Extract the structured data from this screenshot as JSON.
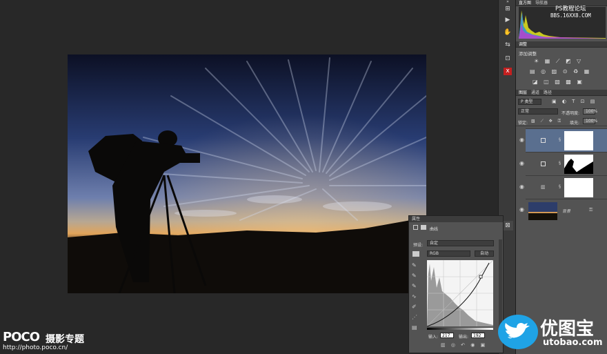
{
  "toolstrip": {
    "collapse": "»",
    "items": [
      "⊞",
      "▶",
      "✋",
      "⇆",
      "⊡",
      "⊠",
      "x"
    ]
  },
  "panels": {
    "histogram_tabs": [
      "直方图",
      "导航器"
    ],
    "adjustments_tab": "调整",
    "add_adjustment": "添加调整",
    "adj_row1": "☀ ▦ ⟋ ◩ ▽",
    "adj_row2": "▤ ◎ ▨ ⊙ ♻ ▦",
    "adj_row3": "◪ ◫ ▧ ▩ ▣",
    "layers_tabs": [
      "图层",
      "通道",
      "路径"
    ],
    "filter_kind": "P 类型",
    "blend_mode": "正常",
    "opacity_label": "不透明度:",
    "opacity_value": "100%",
    "lock_label": "锁定:",
    "fill_label": "填充:",
    "fill_value": "100%",
    "layers": [
      {
        "name": ""
      },
      {
        "name": ""
      },
      {
        "name": ""
      },
      {
        "name": "背景"
      }
    ]
  },
  "properties": {
    "title": "属性",
    "panel_name": "曲线",
    "preset_label": "预设:",
    "preset_value": "自定",
    "channel_value": "RGB",
    "auto_button": "自动",
    "input_label": "输入:",
    "input_value": "217",
    "output_label": "输出:",
    "output_value": "192"
  },
  "watermarks": {
    "ps_title": "PS教程论坛",
    "ps_url": "BBS.16XX8.COM",
    "poco_brand": "POCO",
    "poco_title": "摄影专题",
    "poco_url": "http://photo.poco.cn/",
    "utobao_title": "优图宝",
    "utobao_url": "utobao.com"
  },
  "colors": {
    "workspace": "#282828",
    "panel": "#535353",
    "dark_panel": "#3c3c3c",
    "selected_layer": "#5a6f8f",
    "twitter_blue": "#1fa3e6"
  }
}
